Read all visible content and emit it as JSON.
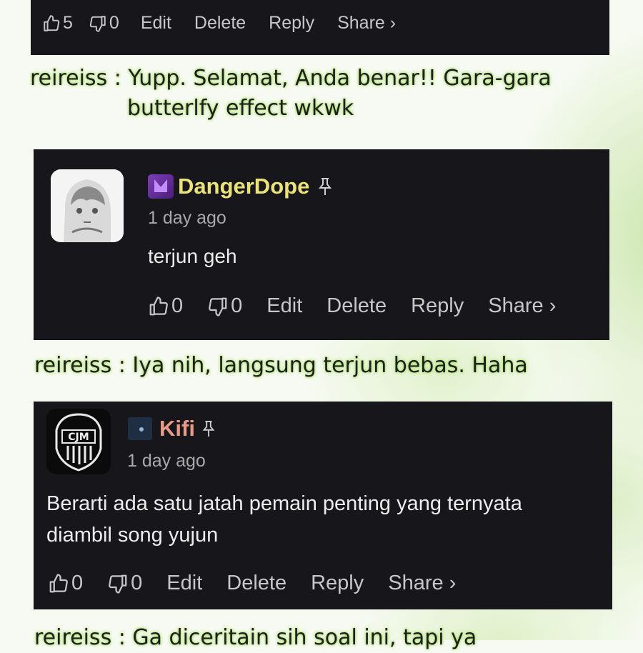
{
  "card1": {
    "likes": "5",
    "dislikes": "0",
    "edit": "Edit",
    "delete": "Delete",
    "reply": "Reply",
    "share": "Share ›"
  },
  "caption1": {
    "line1": "reireiss : Yupp. Selamat, Anda benar!! Gara-gara",
    "line2": "butterlfy effect wkwk"
  },
  "card2": {
    "username": "DangerDope",
    "time": "1 day ago",
    "text": "terjun geh",
    "likes": "0",
    "dislikes": "0",
    "edit": "Edit",
    "delete": "Delete",
    "reply": "Reply",
    "share": "Share ›",
    "username_color": "#ece27a"
  },
  "caption2": {
    "line1": "reireiss : Iya nih, langsung terjun bebas. Haha"
  },
  "card3": {
    "username": "Kifi",
    "time": "1 day ago",
    "text_line1": "Berarti ada satu jatah pemain penting yang ternyata",
    "text_line2": "diambil song yujun",
    "likes": "0",
    "dislikes": "0",
    "edit": "Edit",
    "delete": "Delete",
    "reply": "Reply",
    "share": "Share ›",
    "username_color": "#e89a86",
    "avatar_text": "CJM"
  },
  "caption3": {
    "line1": "reireiss : Ga diceritain sih soal ini, tapi ya"
  },
  "icons": [
    "thumbs-up-icon",
    "thumbs-down-icon",
    "pin-icon",
    "badge-icon"
  ]
}
